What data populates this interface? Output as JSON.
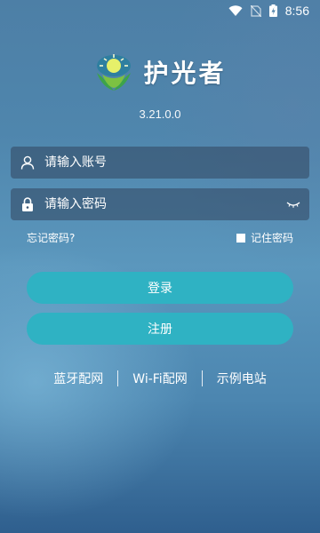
{
  "status_bar": {
    "time": "8:56"
  },
  "brand": {
    "name": "护光者",
    "version": "3.21.0.0"
  },
  "login": {
    "account_placeholder": "请输入账号",
    "password_placeholder": "请输入密码",
    "forgot_password": "忘记密码?",
    "remember_password": "记住密码",
    "login_button": "登录",
    "register_button": "注册"
  },
  "bottom_links": {
    "bluetooth": "蓝牙配网",
    "wifi": "Wi-Fi配网",
    "demo": "示例电站"
  },
  "icons": {
    "wifi": "wifi-icon",
    "sim": "no-sim-icon",
    "battery": "battery-charging-icon",
    "logo": "sun-leaf-logo",
    "user": "user-icon",
    "lock": "lock-icon",
    "eye": "eye-closed-icon"
  },
  "colors": {
    "accent": "#2fb2c3"
  }
}
